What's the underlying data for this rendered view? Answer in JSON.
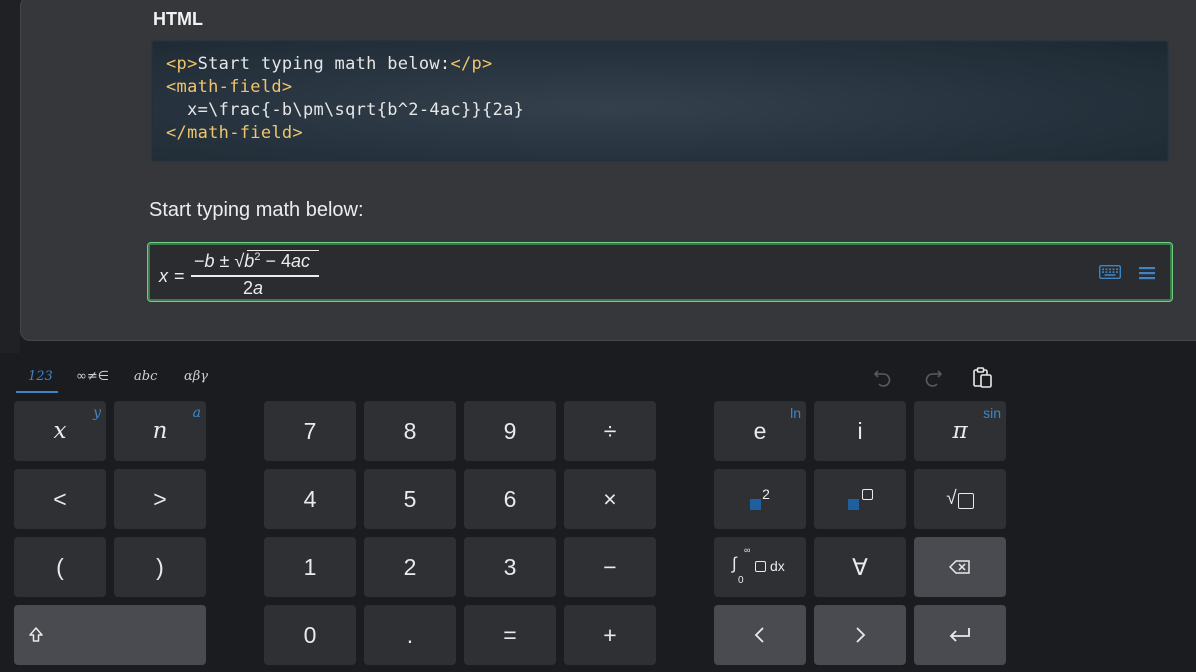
{
  "doc": {
    "heading": "HTML",
    "code": {
      "line1_open": "<p>",
      "line1_text": "Start typing math below:",
      "line1_close": "</p>",
      "line2": "<math-field>",
      "line3": "  x=\\frac{-b\\pm\\sqrt{b^2-4ac}}{2a}",
      "line4": "</math-field>"
    },
    "prompt": "Start typing math below:"
  },
  "math_field": {
    "x": "x",
    "eq": "=",
    "numerator_minus": "−",
    "numerator_b": "b",
    "numerator_pm": " ± √",
    "numerator_b2": "b",
    "numerator_exp": "2",
    "numerator_rest": " − 4",
    "numerator_ac": "ac",
    "denominator_num": "2",
    "denominator_var": "a",
    "virtual_keyboard_toggle": "keyboard-icon",
    "menu_toggle": "menu-icon"
  },
  "keyboard": {
    "tabs": [
      "123",
      "∞≠∈",
      "abc",
      "αβγ"
    ],
    "active_tab": "123",
    "toolbar": [
      "undo-icon",
      "redo-icon",
      "clipboard-icon"
    ],
    "accent": "#3d86c6",
    "rows": [
      {
        "vars": [
          {
            "label": "x",
            "shift": "y"
          },
          {
            "label": "n",
            "shift": "a"
          }
        ],
        "digits": [
          "7",
          "8",
          "9",
          "÷"
        ],
        "funcs": [
          {
            "label": "e",
            "shift": "ln"
          },
          {
            "label": "i",
            "shift": ""
          },
          {
            "label": "π",
            "shift": "sin"
          }
        ]
      },
      {
        "vars": [
          {
            "label": "<",
            "shift": ""
          },
          {
            "label": ">",
            "shift": ""
          }
        ],
        "digits": [
          "4",
          "5",
          "6",
          "×"
        ],
        "funcs": [
          {
            "label": "2",
            "shift": ""
          },
          {
            "label": "",
            "shift": ""
          },
          {
            "label": "√",
            "shift": ""
          }
        ]
      },
      {
        "vars": [
          {
            "label": "(",
            "shift": ""
          },
          {
            "label": ")",
            "shift": ""
          }
        ],
        "digits": [
          "1",
          "2",
          "3",
          "−"
        ],
        "funcs": [
          {
            "label": "dx",
            "shift": ""
          },
          {
            "label": "∀",
            "shift": ""
          },
          {
            "label": "backspace-icon",
            "shift": ""
          }
        ]
      },
      {
        "vars": [
          {
            "label": "shift-icon",
            "shift": ""
          }
        ],
        "digits": [
          "0",
          ".",
          "=",
          "+"
        ],
        "funcs": [
          {
            "label": "left-arrow-icon",
            "shift": ""
          },
          {
            "label": "right-arrow-icon",
            "shift": ""
          },
          {
            "label": "enter-icon",
            "shift": ""
          }
        ]
      }
    ],
    "integral": {
      "upper": "∞",
      "lower": "0",
      "symbol": "∫",
      "dx": "dx"
    }
  }
}
